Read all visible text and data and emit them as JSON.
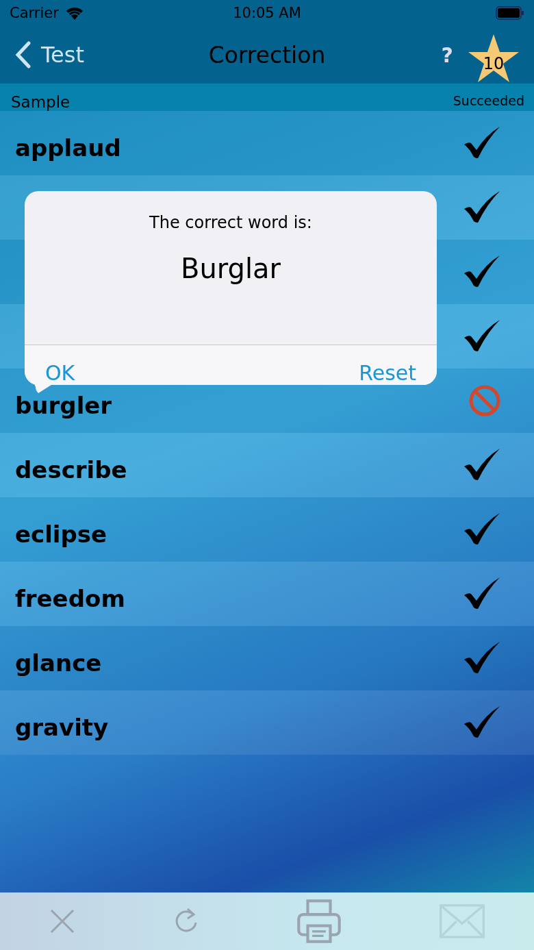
{
  "status_bar": {
    "carrier": "Carrier",
    "time": "10:05 AM"
  },
  "nav": {
    "back": "Test",
    "title": "Correction",
    "help": "?",
    "score": "10"
  },
  "header": {
    "column_1": "Sample",
    "column_2": "Succeeded"
  },
  "rows": [
    {
      "word": "applaud",
      "succeeded": true
    },
    {
      "succeeded": true
    },
    {
      "succeeded": true
    },
    {
      "succeeded": true
    },
    {
      "word": "burgler",
      "succeeded": false
    },
    {
      "word": "describe",
      "succeeded": true
    },
    {
      "word": "eclipse",
      "succeeded": true
    },
    {
      "word": "freedom",
      "succeeded": true
    },
    {
      "word": "glance",
      "succeeded": true
    },
    {
      "word": "gravity",
      "succeeded": true
    }
  ],
  "alert": {
    "message": "The correct word is:",
    "word": "Burglar",
    "buttons": [
      "OK",
      "Reset"
    ]
  },
  "toolbar": [
    {
      "kind": "close",
      "disabled": false
    },
    {
      "kind": "refresh",
      "disabled": false
    },
    {
      "kind": "print",
      "disabled": false
    },
    {
      "kind": "mail",
      "disabled": true
    }
  ]
}
